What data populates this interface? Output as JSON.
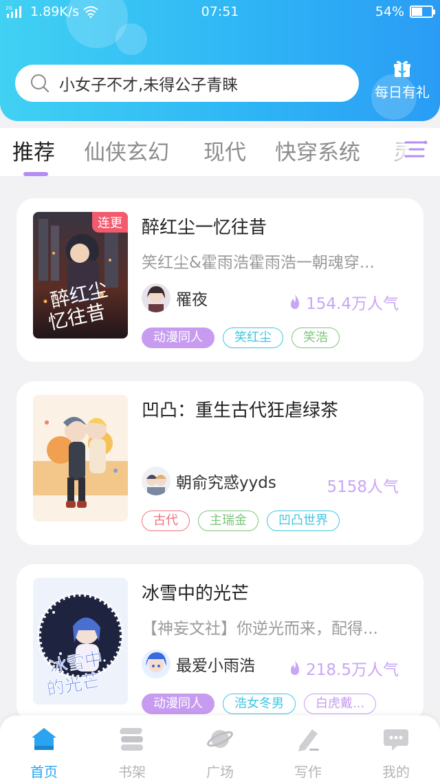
{
  "status_bar": {
    "network": "2G",
    "speed": "1.89K/s",
    "time": "07:51",
    "battery": "54%",
    "battery_level": 0.54
  },
  "search": {
    "placeholder": "小女子不才,未得公子青睐"
  },
  "daily_gift": {
    "label": "每日有礼"
  },
  "tabs": [
    {
      "label": "推荐",
      "active": true
    },
    {
      "label": "仙侠玄幻",
      "active": false
    },
    {
      "label": "现代",
      "active": false
    },
    {
      "label": "快穿系统",
      "active": false
    },
    {
      "label": "灵异",
      "active": false
    }
  ],
  "books": [
    {
      "badge": "连更",
      "title": "醉红尘一忆往昔",
      "cover_text": "醉红尘一忆往昔",
      "description": "笑红尘&霍雨浩霍雨浩一朝魂穿...",
      "author": "罹夜",
      "popularity": "154.4万人气",
      "tags": [
        {
          "label": "动漫同人",
          "color": "#c79cf0",
          "filled": true
        },
        {
          "label": "笑红尘",
          "color": "#3cc6e2",
          "filled": false
        },
        {
          "label": "笑浩",
          "color": "#7cc57a",
          "filled": false
        }
      ]
    },
    {
      "title": "凹凸：重生古代狂虐绿茶",
      "description": "",
      "author": "朝俞究惑yyds",
      "popularity": "5158人气",
      "tags": [
        {
          "label": "古代",
          "color": "#f0707c",
          "filled": false
        },
        {
          "label": "主瑞金",
          "color": "#7cc57a",
          "filled": false
        },
        {
          "label": "凹凸世界",
          "color": "#3cc6e2",
          "filled": false
        }
      ]
    },
    {
      "title": "冰雪中的光芒",
      "cover_text": "冰雪中的光芒",
      "description": "【神妄文社】你逆光而来，配得...",
      "author": "最爱小雨浩",
      "popularity": "218.5万人气",
      "tags": [
        {
          "label": "动漫同人",
          "color": "#c79cf0",
          "filled": true
        },
        {
          "label": "浩女冬男",
          "color": "#3cc6e2",
          "filled": false
        },
        {
          "label": "白虎戴...",
          "color": "#c79cf0",
          "filled": false
        }
      ]
    }
  ],
  "bottom_nav": [
    {
      "label": "首页",
      "icon": "home-icon",
      "active": true
    },
    {
      "label": "书架",
      "icon": "bookshelf-icon",
      "active": false
    },
    {
      "label": "广场",
      "icon": "planet-icon",
      "active": false
    },
    {
      "label": "写作",
      "icon": "pen-icon",
      "active": false
    },
    {
      "label": "我的",
      "icon": "chat-bubble-icon",
      "active": false
    }
  ],
  "colors": {
    "accent": "#2aa4f0",
    "tab_indicator": "#b58cf2",
    "popularity": "#c7a6f5",
    "badge": "#f25b6e"
  }
}
